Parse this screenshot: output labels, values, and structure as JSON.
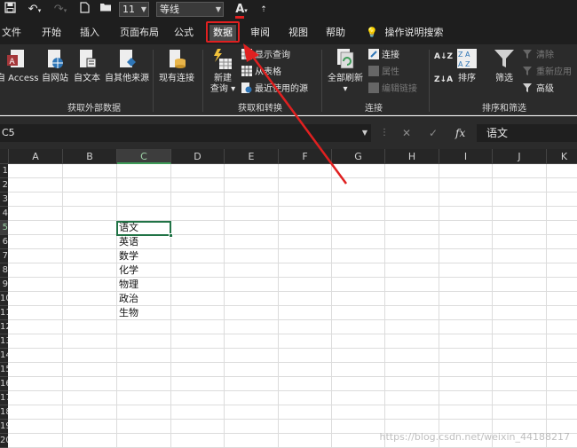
{
  "qat": {
    "font_size": "11",
    "font_name": "等线",
    "font_color_glyph": "A"
  },
  "tabs": [
    "文件",
    "开始",
    "插入",
    "页面布局",
    "公式",
    "数据",
    "审阅",
    "视图",
    "帮助",
    "操作说明搜索"
  ],
  "active_tab": "数据",
  "ribbon": {
    "get_external": {
      "label": "获取外部数据",
      "buttons": [
        "自 Access",
        "自网站",
        "自文本",
        "自其他来源",
        "现有连接"
      ]
    },
    "get_transform": {
      "label": "获取和转换",
      "new_query": [
        "新建",
        "查询 ▾"
      ],
      "items": [
        "显示查询",
        "从表格",
        "最近使用的源"
      ]
    },
    "connections": {
      "label": "连接",
      "refresh_all": [
        "全部刷新",
        "▾"
      ],
      "items": [
        "连接",
        "属性",
        "编辑链接"
      ]
    },
    "sort_filter": {
      "label": "排序和筛选",
      "sort": "排序",
      "filter": "筛选",
      "items": [
        "清除",
        "重新应用",
        "高级"
      ]
    }
  },
  "formula_bar": {
    "name_box": "C5",
    "fx": "fx",
    "content": "语文"
  },
  "grid": {
    "columns": [
      "A",
      "B",
      "C",
      "D",
      "E",
      "F",
      "G",
      "H",
      "I",
      "J",
      "K"
    ],
    "selected_column": "C",
    "rows": [
      "1",
      "2",
      "3",
      "4",
      "5",
      "6",
      "7",
      "8",
      "9",
      "10",
      "11",
      "12",
      "13",
      "14",
      "15",
      "16",
      "17",
      "18",
      "19",
      "20"
    ],
    "selected_row": "5",
    "c_column_values": [
      "语文",
      "英语",
      "数学",
      "化学",
      "物理",
      "政治",
      "生物"
    ]
  },
  "watermark": "https://blog.csdn.net/weixin_44188217",
  "colors": {
    "annotation_red": "#e02020",
    "excel_green": "#217346"
  }
}
